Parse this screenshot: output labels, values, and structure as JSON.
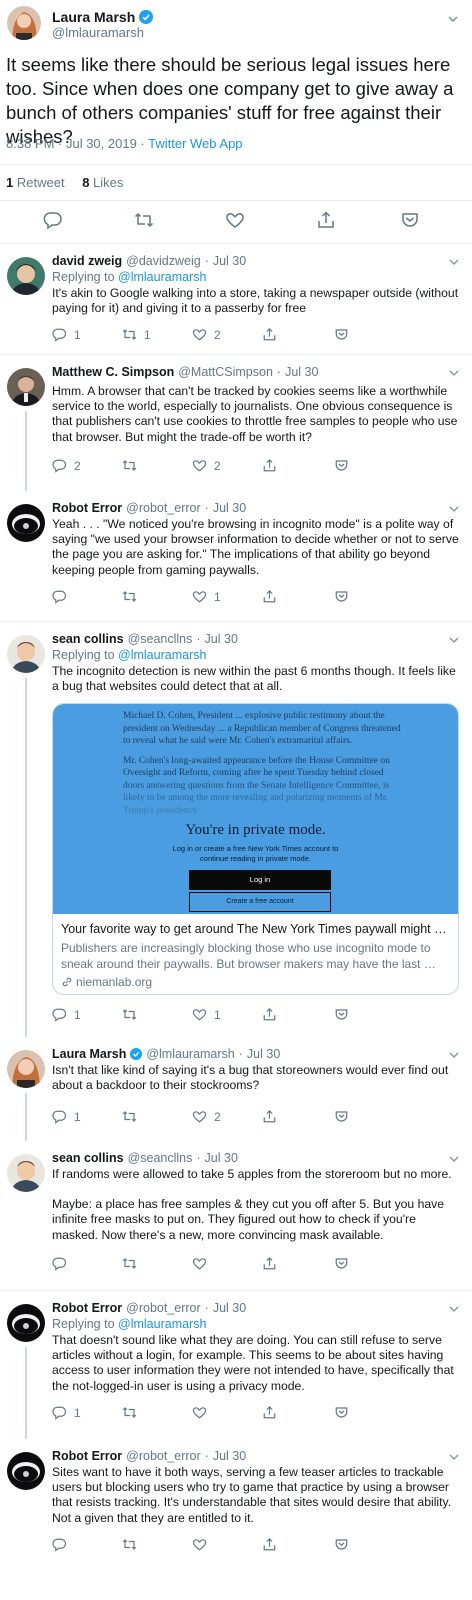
{
  "main": {
    "author": "Laura Marsh",
    "handle": "@lmlauramarsh",
    "verified": true,
    "text": "It seems like there should be serious legal issues here too. Since when does one company get to give away a bunch of others companies' stuff for free against their wishes?",
    "time": "8:38 PM · Jul 30, 2019 · ",
    "app": "Twitter Web App",
    "retweets": "1",
    "retweets_label": "Retweet",
    "likes": "8",
    "likes_label": "Likes"
  },
  "colors": {
    "link": "#1b95e0",
    "muted": "#657786",
    "thread": "#ccd6dd",
    "divider": "#e6ecf0"
  },
  "replies": [
    {
      "name": "david zweig",
      "handle": "@davidzweig",
      "date": "Jul 30",
      "replying_prefix": "Replying to ",
      "replying_to": "@lmlauramarsh",
      "text": "It's akin to Google walking into a store, taking a newspaper outside (without paying for it) and giving it to a passerby for free",
      "reply_count": "1",
      "retweet_count": "1",
      "like_count": "2"
    },
    {
      "name": "Matthew C. Simpson",
      "handle": "@MattCSimpson",
      "date": "Jul 30",
      "text": "Hmm. A browser that can't be tracked by cookies seems like a worthwhile service to the world, especially to journalists. One obvious consequence is that publishers can't use cookies to throttle free samples to people who use that browser. But might the trade-off be worth it?",
      "reply_count": "2",
      "retweet_count": "",
      "like_count": "2"
    },
    {
      "name": "Robot Error",
      "handle": "@robot_error",
      "date": "Jul 30",
      "text": "Yeah . . . \"We noticed you're browsing in incognito mode\" is a polite way of saying \"we used your browser information to decide whether or not to serve the page you are asking for.\" The implications of that ability go beyond keeping people from gaming paywalls.",
      "reply_count": "",
      "retweet_count": "",
      "like_count": "1"
    },
    {
      "name": "sean collins",
      "handle": "@seancllns",
      "date": "Jul 30",
      "replying_prefix": "Replying to ",
      "replying_to": "@lmlauramarsh",
      "text": "The incognito detection is new within the past 6 months though. It feels like a bug that websites could detect that at all.",
      "reply_count": "1",
      "retweet_count": "",
      "like_count": "1",
      "card": {
        "article_p1": "Michael D. Cohen, President ... explosive public testimony about the president on Wednesday ... a Republican member of Congress threatened to reveal what he said were Mr. Cohen's extramarital affairs.",
        "article_p2": "Mr. Cohen's long-awaited appearance before the House Committee on Oversight and Reform, coming after he spent Tuesday behind closed doors answering questions from the Senate Intelligence Committee, is likely to be among the more revealing and polarizing moments of Mr. Trump's presidency.",
        "overlay_title": "You're in private mode.",
        "overlay_sub": "Log in or create a free New York Times account to continue reading in private mode.",
        "login_label": "Log in",
        "create_label": "Create a free account",
        "title": "Your favorite way to get around The New York Times paywall might be …",
        "description": "Publishers are increasingly blocking those who use incognito mode to sneak around their paywalls. But browser makers may have the last …",
        "domain": "niemanlab.org"
      }
    },
    {
      "name": "Laura Marsh",
      "handle": "@lmlauramarsh",
      "date": "Jul 30",
      "verified": true,
      "text": "Isn't that like kind of saying it's a bug that storeowners would ever find out about a backdoor to their stockrooms?",
      "reply_count": "1",
      "retweet_count": "",
      "like_count": "2"
    },
    {
      "name": "sean collins",
      "handle": "@seancllns",
      "date": "Jul 30",
      "text": "If randoms were allowed to take 5 apples from the storeroom but no more.",
      "text2": "Maybe: a place has free samples & they cut you off after 5. But you have infinite free masks to put on. They figured out how to check if you're masked. Now there's a new, more convincing mask available.",
      "reply_count": "",
      "retweet_count": "",
      "like_count": ""
    },
    {
      "name": "Robot Error",
      "handle": "@robot_error",
      "date": "Jul 30",
      "replying_prefix": "Replying to ",
      "replying_to": "@lmlauramarsh",
      "text": "That doesn't sound like what they are doing. You can still refuse to serve articles without a login, for example. This seems to be about sites having access to user information they were not intended to have, specifically that the not-logged-in user is using a privacy mode.",
      "reply_count": "1",
      "retweet_count": "",
      "like_count": ""
    },
    {
      "name": "Robot Error",
      "handle": "@robot_error",
      "date": "Jul 30",
      "text": "Sites want to have it both ways, serving a few teaser articles to trackable users but blocking users who try to game that practice by using a browser that resists tracking. It's understandable that sites would desire that ability. Not a given that they are entitled to it.",
      "reply_count": "",
      "retweet_count": "",
      "like_count": ""
    }
  ]
}
